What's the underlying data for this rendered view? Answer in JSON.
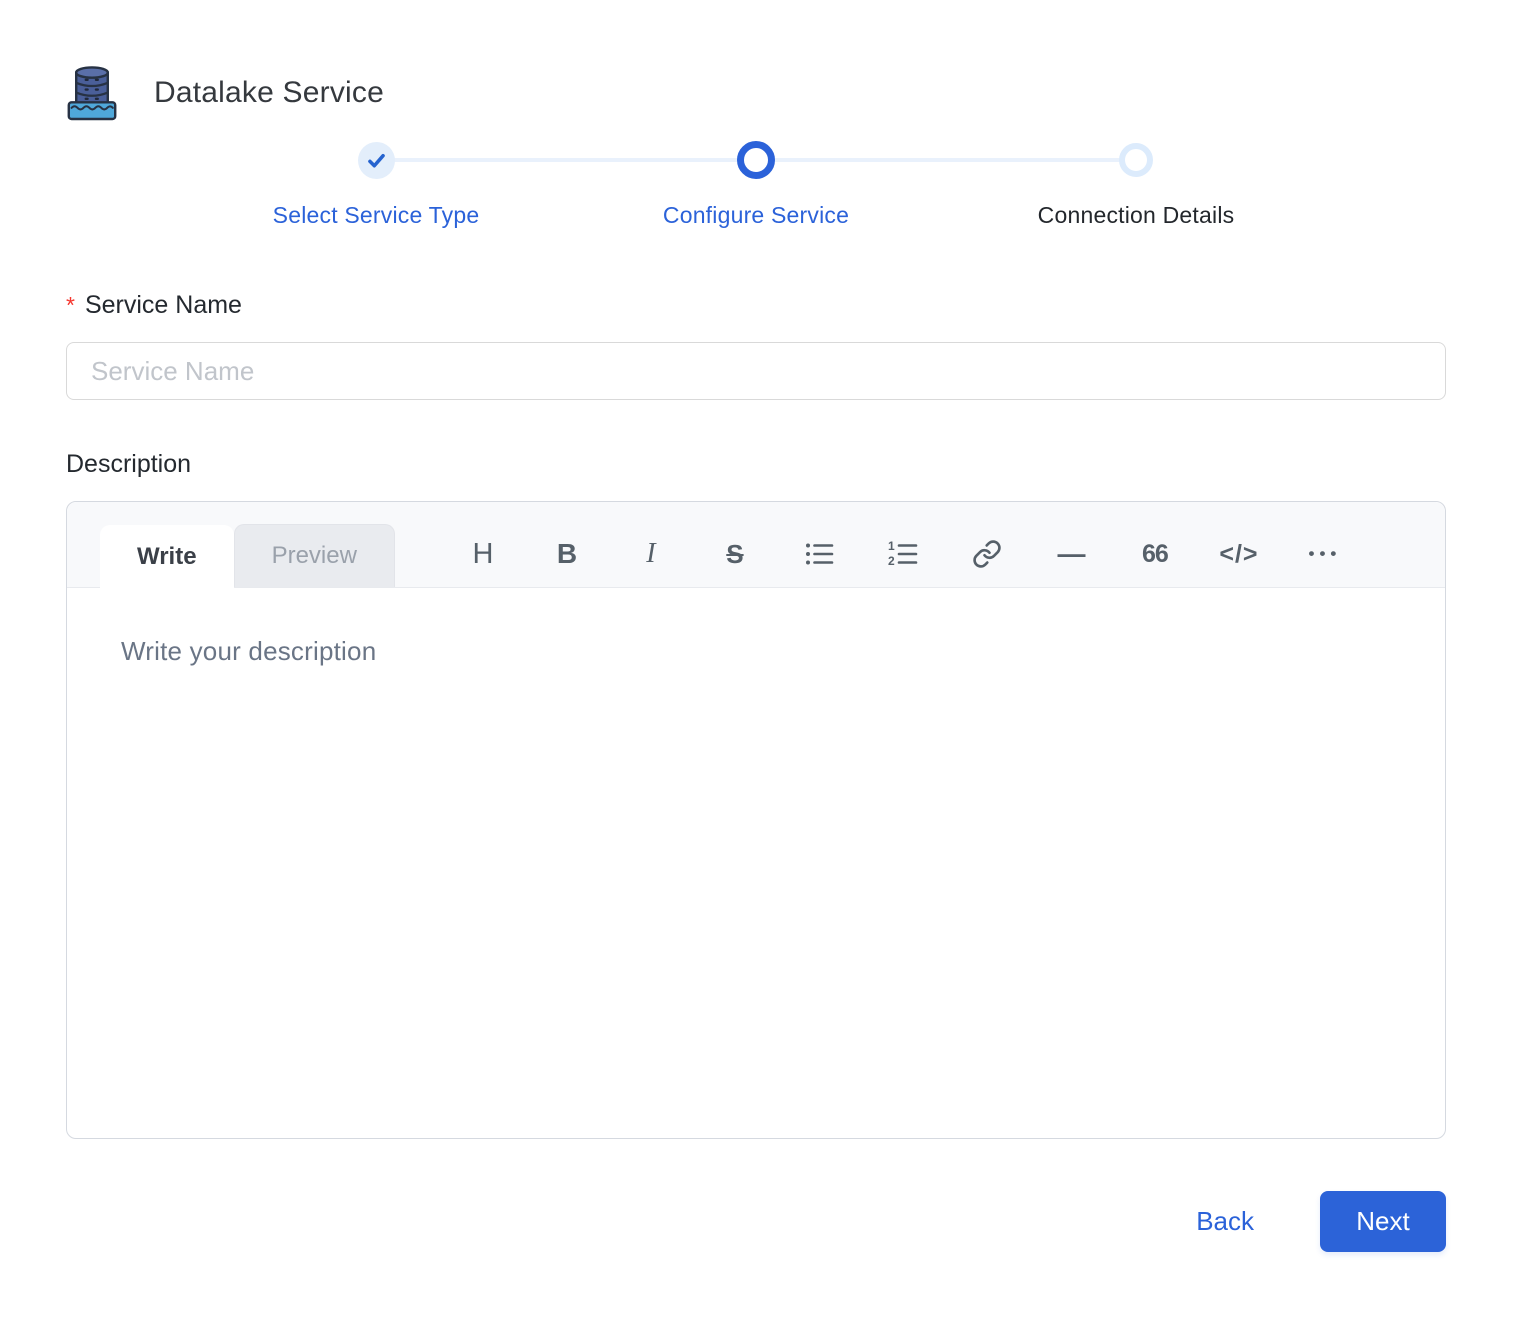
{
  "header": {
    "title": "Datalake Service",
    "icon": "datalake-icon"
  },
  "stepper": {
    "steps": [
      {
        "label": "Select Service Type",
        "state": "completed",
        "icon": "check-icon"
      },
      {
        "label": "Configure Service",
        "state": "active"
      },
      {
        "label": "Connection Details",
        "state": "pending"
      }
    ]
  },
  "form": {
    "service_name": {
      "label": "Service Name",
      "required_marker": "*",
      "value": "",
      "placeholder": "Service Name"
    },
    "description": {
      "label": "Description",
      "value": "",
      "placeholder": "Write your description"
    }
  },
  "editor": {
    "tabs": [
      {
        "label": "Write",
        "active": true
      },
      {
        "label": "Preview",
        "active": false
      }
    ],
    "toolbar": [
      {
        "name": "heading-icon",
        "glyph": "H"
      },
      {
        "name": "bold-icon",
        "glyph": "B"
      },
      {
        "name": "italic-icon",
        "glyph": "I"
      },
      {
        "name": "strikethrough-icon",
        "glyph": "S"
      },
      {
        "name": "unordered-list-icon",
        "glyph": null
      },
      {
        "name": "ordered-list-icon",
        "glyph": null
      },
      {
        "name": "link-icon",
        "glyph": null
      },
      {
        "name": "horizontal-rule-icon",
        "glyph": "—"
      },
      {
        "name": "quote-icon",
        "glyph": "66"
      },
      {
        "name": "code-icon",
        "glyph": "</>"
      },
      {
        "name": "more-icon",
        "glyph": "•••"
      }
    ]
  },
  "footer": {
    "back_label": "Back",
    "next_label": "Next"
  },
  "colors": {
    "accent_blue": "#2b62d9",
    "completed_dot_bg": "#e3eefb",
    "pending_dot_ring": "#dcebfc",
    "connector_line": "#e9f1fc",
    "required_red": "#f5372f",
    "toolbar_icon_gray": "#566069",
    "placeholder_gray": "#c1c5cb",
    "editor_header_bg": "#f8f9fb"
  }
}
